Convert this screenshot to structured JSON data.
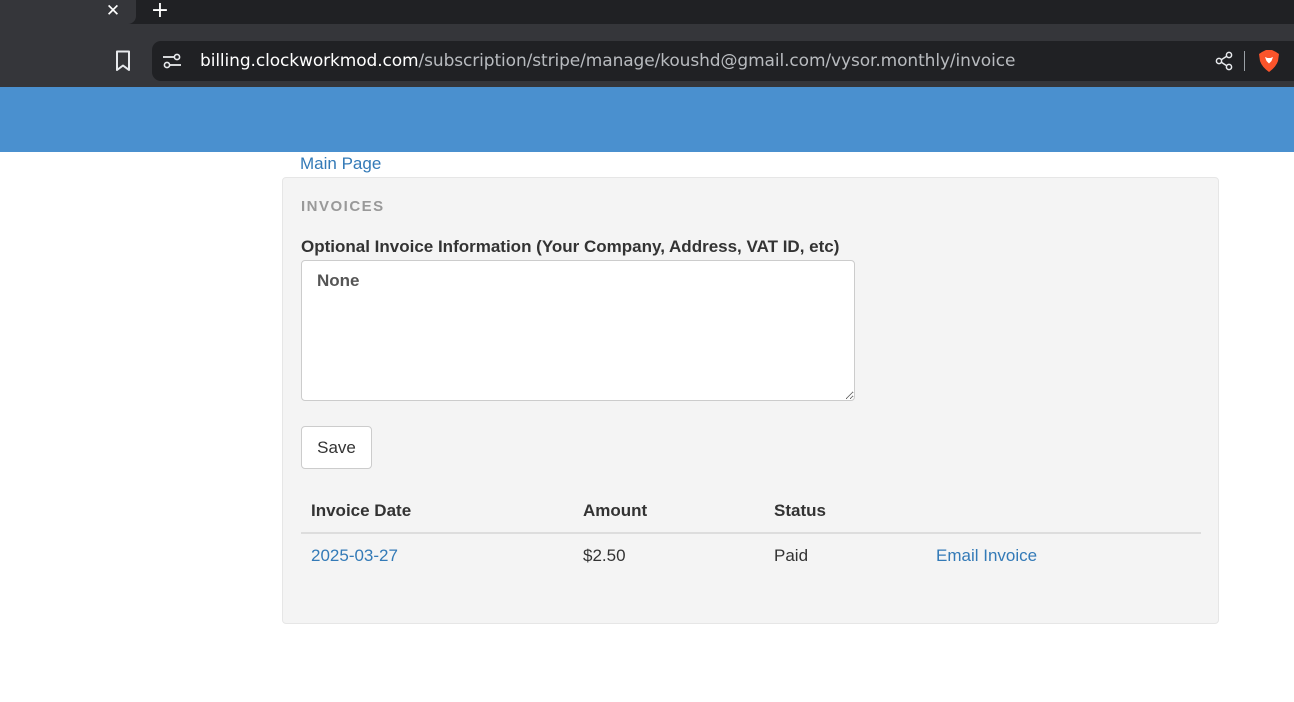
{
  "browser": {
    "tab_close_glyph": "✕",
    "new_tab_glyph": "+",
    "url_host": "billing.clockworkmod.com",
    "url_path": "/subscription/stripe/manage/koushd@gmail.com/vysor.monthly/invoice",
    "icons": [
      "close-icon",
      "plus-icon",
      "bookmark-icon",
      "site-settings-icon",
      "share-icon",
      "brave-shields-icon"
    ],
    "colors": {
      "chrome_dark": "#202124",
      "toolbar": "#35363a",
      "brave_orange": "#fb542b"
    }
  },
  "page": {
    "header_color": "#4a90cf",
    "main_link": "Main Page",
    "section_title": "INVOICES",
    "info_label": "Optional Invoice Information (Your Company, Address, VAT ID, etc)",
    "info_value": "None",
    "save_label": "Save",
    "link_color": "#337ab7"
  },
  "table": {
    "headers": {
      "date": "Invoice Date",
      "amount": "Amount",
      "status": "Status",
      "action": ""
    },
    "rows": [
      {
        "date": "2025-03-27",
        "amount": "$2.50",
        "status": "Paid",
        "action": "Email Invoice"
      }
    ]
  }
}
